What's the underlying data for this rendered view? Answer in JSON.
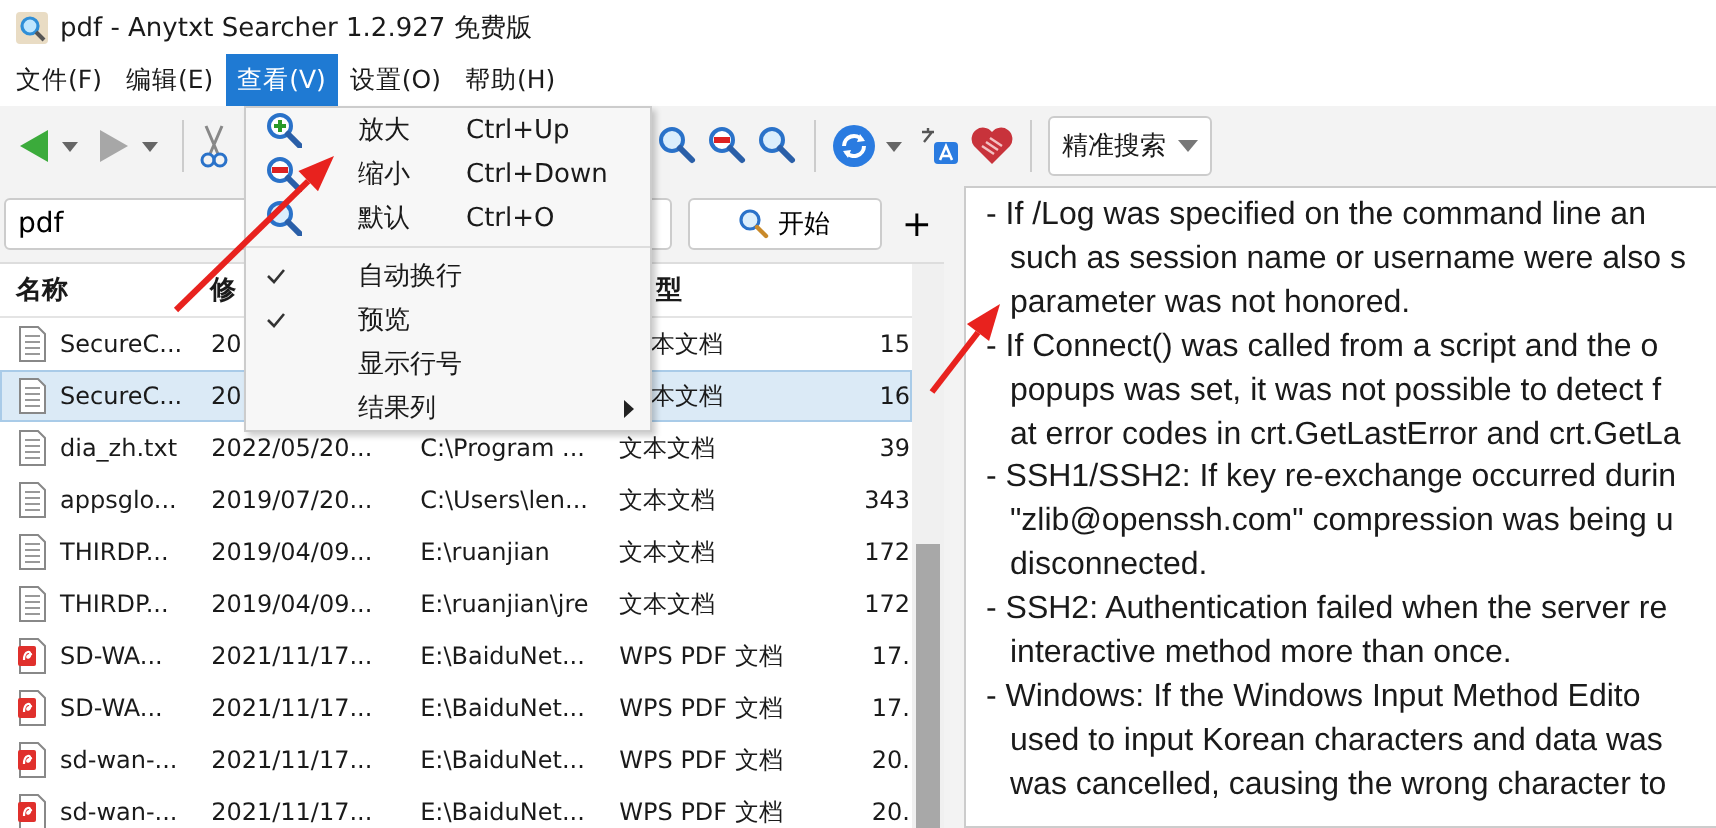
{
  "window": {
    "title": "pdf - Anytxt Searcher 1.2.927 免费版"
  },
  "menu_bar": [
    {
      "label": "文件(F)",
      "selected": false
    },
    {
      "label": "编辑(E)",
      "selected": false
    },
    {
      "label": "查看(V)",
      "selected": true
    },
    {
      "label": "设置(O)",
      "selected": false
    },
    {
      "label": "帮助(H)",
      "selected": false
    }
  ],
  "toolbar": {
    "search_mode": "精准搜索"
  },
  "search": {
    "value": "pdf",
    "button": "开始",
    "add": "+"
  },
  "table": {
    "columns": [
      "名称",
      "修",
      "型"
    ],
    "rows": [
      {
        "kind": "text",
        "name": "SecureC...",
        "modified": "20",
        "type": "本文档",
        "size": "15",
        "selected": false
      },
      {
        "kind": "text",
        "name": "SecureC...",
        "modified": "20",
        "type": "本文档",
        "size": "16",
        "selected": true
      },
      {
        "kind": "text",
        "name": "dia_zh.txt",
        "modified": "2022/05/20...",
        "path": "C:\\Program ...",
        "type": "文本文档",
        "size": "39",
        "selected": false
      },
      {
        "kind": "text",
        "name": "appsglo...",
        "modified": "2019/07/20...",
        "path": "C:\\Users\\len...",
        "type": "文本文档",
        "size": "343",
        "selected": false
      },
      {
        "kind": "text",
        "name": "THIRDP...",
        "modified": "2019/04/09...",
        "path": "E:\\ruanjian",
        "type": "文本文档",
        "size": "172",
        "selected": false
      },
      {
        "kind": "text",
        "name": "THIRDP...",
        "modified": "2019/04/09...",
        "path": "E:\\ruanjian\\jre",
        "type": "文本文档",
        "size": "172",
        "selected": false
      },
      {
        "kind": "pdf",
        "name": "SD-WA...",
        "modified": "2021/11/17...",
        "path": "E:\\BaiduNet...",
        "type": "WPS PDF 文档",
        "size": "17.",
        "selected": false
      },
      {
        "kind": "pdf",
        "name": "SD-WA...",
        "modified": "2021/11/17...",
        "path": "E:\\BaiduNet...",
        "type": "WPS PDF 文档",
        "size": "17.",
        "selected": false
      },
      {
        "kind": "pdf",
        "name": "sd-wan-...",
        "modified": "2021/11/17...",
        "path": "E:\\BaiduNet...",
        "type": "WPS PDF 文档",
        "size": "20.",
        "selected": false
      },
      {
        "kind": "pdf",
        "name": "sd-wan-...",
        "modified": "2021/11/17...",
        "path": "E:\\BaiduNet...",
        "type": "WPS PDF 文档",
        "size": "20.",
        "selected": false
      }
    ]
  },
  "view_menu": [
    {
      "kind": "action",
      "label": "放大",
      "shortcut": "Ctrl+Up"
    },
    {
      "kind": "action",
      "label": "缩小",
      "shortcut": "Ctrl+Down"
    },
    {
      "kind": "action",
      "label": "默认",
      "shortcut": "Ctrl+O"
    },
    {
      "kind": "separator"
    },
    {
      "kind": "toggle",
      "label": "自动换行",
      "checked": true
    },
    {
      "kind": "toggle",
      "label": "预览",
      "checked": true
    },
    {
      "kind": "toggle",
      "label": "显示行号",
      "checked": false
    },
    {
      "kind": "submenu",
      "label": "结果列"
    }
  ],
  "preview": [
    {
      "kind": "bullet",
      "text": "- If /Log was specified on the command line an"
    },
    {
      "kind": "continuation",
      "text": "such as session name or username were also s"
    },
    {
      "kind": "continuation",
      "text": "parameter was not honored."
    },
    {
      "kind": "bullet",
      "text": "- If Connect() was called from a script and the o"
    },
    {
      "kind": "continuation",
      "text": "popups was set, it was not possible to detect f"
    },
    {
      "kind": "continuation",
      "text": "at error codes in crt.GetLastError and crt.GetLa"
    },
    {
      "kind": "bullet",
      "text": "- SSH1/SSH2: If key re-exchange occurred durin"
    },
    {
      "kind": "continuation",
      "text": "\"zlib@openssh.com\" compression was being u"
    },
    {
      "kind": "continuation",
      "text": "disconnected."
    },
    {
      "kind": "bullet",
      "text": "- SSH2: Authentication failed when the server re"
    },
    {
      "kind": "continuation",
      "text": "interactive method more than once."
    },
    {
      "kind": "bullet",
      "text": "- Windows: If the Windows Input Method Edito"
    },
    {
      "kind": "continuation",
      "text": "used to input Korean characters and data was"
    },
    {
      "kind": "continuation",
      "text": "was cancelled, causing the wrong character to"
    }
  ]
}
